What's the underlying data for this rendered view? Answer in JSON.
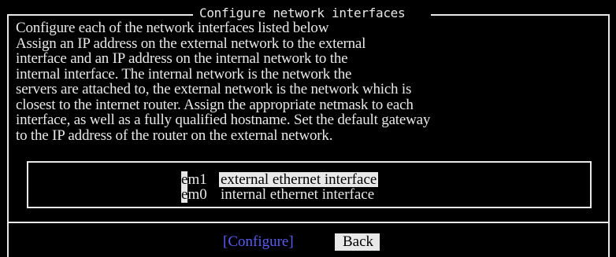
{
  "dialog": {
    "title": "Configure network interfaces",
    "body_lines": [
      "Configure each of the network interfaces listed below",
      "Assign an IP address on the external network to the external",
      "interface and an IP address on the internal network to the",
      "internal interface. The internal network is the network the",
      "servers are attached to, the external network is the network which is",
      "closest to the internet router. Assign the appropriate netmask to each",
      "interface, as well as a fully qualified hostname. Set the default gateway",
      "to the IP address of the router on the external network."
    ],
    "interfaces": [
      {
        "hotkey": "e",
        "rest": "m1",
        "description": "external ethernet interface",
        "selected": true
      },
      {
        "hotkey": "e",
        "rest": "m0",
        "description": "internal ethernet interface",
        "selected": false
      }
    ],
    "buttons": {
      "configure_label": "[Configure]",
      "back_label": "Back"
    }
  },
  "colors": {
    "background": "#000000",
    "foreground": "#e8e8e8",
    "active_button": "#5a5cf0"
  }
}
